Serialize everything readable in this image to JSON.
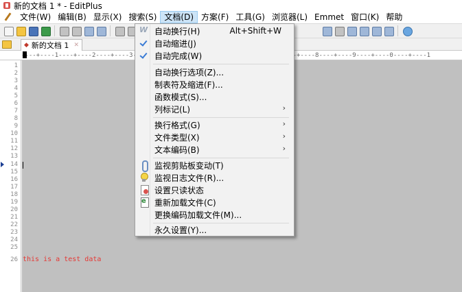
{
  "window": {
    "title": "新的文档 1 * - EditPlus"
  },
  "menubar": {
    "items": [
      "文件(W)",
      "编辑(B)",
      "显示(X)",
      "搜索(S)",
      "文档(D)",
      "方案(F)",
      "工具(G)",
      "浏览器(L)",
      "Emmet",
      "窗口(K)",
      "帮助"
    ],
    "active": "文档(D)"
  },
  "tabs": {
    "folder": "folder-icon",
    "active_tab": "新的文档 1"
  },
  "ruler": {
    "text": "----+----1----+----2----+----3----+----4----+----5----+----6----+----7----+----8----+----9----+----0----+----1"
  },
  "gutter": {
    "line_numbers": [
      "1",
      "2",
      "3",
      "4",
      "5",
      "6",
      "7",
      "8",
      "9",
      "10",
      "11",
      "12",
      "13",
      "14",
      "15",
      "16",
      "17",
      "18",
      "19",
      "20",
      "21",
      "22",
      "23",
      "24",
      "25",
      "26"
    ],
    "current_line": "14"
  },
  "editor": {
    "line_26": "this is a test data"
  },
  "dropdown": {
    "items": [
      {
        "label": "自动换行(H)",
        "shortcut": "Alt+Shift+W",
        "icon": "wrap-w-icon"
      },
      {
        "label": "自动缩进(J)",
        "icon": "check-icon"
      },
      {
        "label": "自动完成(W)",
        "icon": "check-icon"
      },
      {
        "label": "自动换行选项(Z)..."
      },
      {
        "label": "制表符及缩进(F)..."
      },
      {
        "label": "函数模式(S)..."
      },
      {
        "label": "列标记(L)",
        "submenu": true
      },
      {
        "label": "换行格式(G)",
        "submenu": true
      },
      {
        "label": "文件类型(X)",
        "submenu": true
      },
      {
        "label": "文本编码(B)",
        "submenu": true
      },
      {
        "label": "监视剪贴板变动(T)",
        "icon": "clip-icon"
      },
      {
        "label": "监视日志文件(R)...",
        "icon": "bulb-icon"
      },
      {
        "label": "设置只读状态",
        "icon": "lock-doc-icon"
      },
      {
        "label": "重新加载文件(C)",
        "icon": "reload-icon"
      },
      {
        "label": "更换编码加载文件(M)..."
      },
      {
        "label": "永久设置(Y)..."
      }
    ]
  }
}
